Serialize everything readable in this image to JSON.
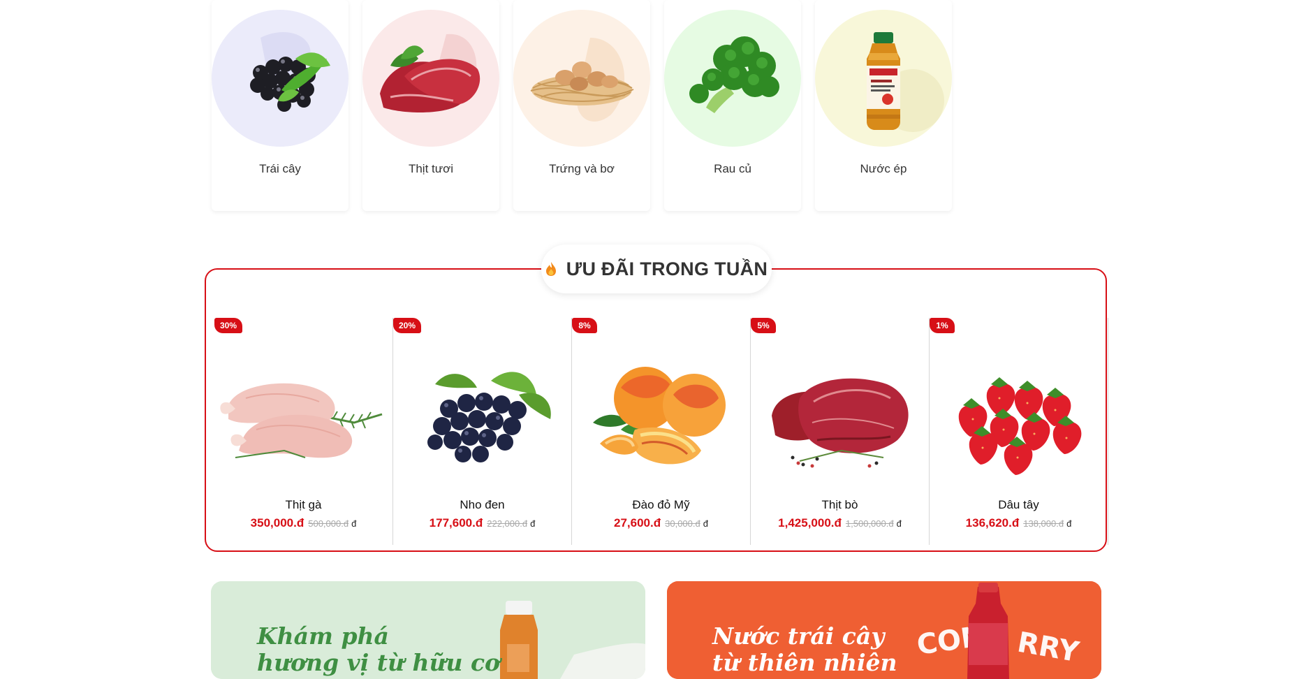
{
  "categories": [
    {
      "label": "Trái cây",
      "icon": "blackberry-icon",
      "bg": "#ebebfa"
    },
    {
      "label": "Thịt tươi",
      "icon": "meat-icon",
      "bg": "#fbe9e9"
    },
    {
      "label": "Trứng và bơ",
      "icon": "eggs-nest-icon",
      "bg": "#fdf1e6"
    },
    {
      "label": "Rau củ",
      "icon": "broccoli-icon",
      "bg": "#e6fbe3"
    },
    {
      "label": "Nước ép",
      "icon": "juice-bottle-icon",
      "bg": "#f8f7d9"
    }
  ],
  "deals": {
    "title": "ƯU ĐÃI TRONG TUẦN",
    "accent": "#d70f16",
    "products": [
      {
        "discount": "30%",
        "name": "Thịt gà",
        "price": "350,000.đ",
        "old_price": "500,000.đ",
        "currency": "đ"
      },
      {
        "discount": "20%",
        "name": "Nho đen",
        "price": "177,600.đ",
        "old_price": "222,000.đ",
        "currency": "đ"
      },
      {
        "discount": "8%",
        "name": "Đào đỏ Mỹ",
        "price": "27,600.đ",
        "old_price": "30,000.đ",
        "currency": "đ"
      },
      {
        "discount": "5%",
        "name": "Thịt bò",
        "price": "1,425,000.đ",
        "old_price": "1,500,000.đ",
        "currency": "đ"
      },
      {
        "discount": "1%",
        "name": "Dâu tây",
        "price": "136,620.đ",
        "old_price": "138,000.đ",
        "currency": "đ"
      }
    ]
  },
  "banners": {
    "left": {
      "line1": "Khám phá",
      "line2": "hương vị từ hữu cơ"
    },
    "right": {
      "line1": "Nước trái cây",
      "line2": "từ thiên nhiên"
    }
  }
}
